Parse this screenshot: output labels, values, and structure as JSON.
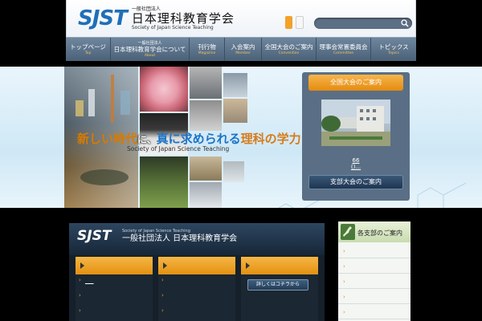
{
  "header": {
    "logo_mark": "SJST",
    "logo_small": "一般社団法人",
    "logo_name": "日本理科教育学会",
    "logo_en": "Society of Japan Science Teaching",
    "search_placeholder": ""
  },
  "nav": [
    {
      "jp": "トップページ",
      "en": "Top"
    },
    {
      "jp_small": "一般社団法人",
      "jp": "日本理科教育学会について",
      "en": "About"
    },
    {
      "jp": "刊行物",
      "en": "Magazine"
    },
    {
      "jp": "入会案内",
      "en": "Member"
    },
    {
      "jp": "全国大会のご案内",
      "en": "Convention"
    },
    {
      "jp": "理事会常置委員会",
      "en": "Committee"
    },
    {
      "jp": "トピックス",
      "en": "Topics"
    }
  ],
  "hero": {
    "tag_a": "新しい時代",
    "tag_b": "に、",
    "tag_c": "真に求められる",
    "tag_d": "",
    "tag_e": "理科の学力",
    "subtitle": "Society of Japan Science Teaching"
  },
  "conference": {
    "title": "全国大会のご案内",
    "line1": "66",
    "line2": "()...",
    "branch_button": "支部大会のご案内"
  },
  "main": {
    "banner_logo": "SJST",
    "banner_en": "Society of Japan Science Teaching",
    "banner_name": "一般社団法人 日本理科教育学会",
    "col1_link": "___",
    "col3_button": "詳しくはコチラから"
  },
  "side": {
    "title": "各支部のご案内"
  },
  "colors": {
    "accent_orange": "#e48b10",
    "brand_blue": "#1f6fb8",
    "nav_bg": "#5a7189"
  }
}
